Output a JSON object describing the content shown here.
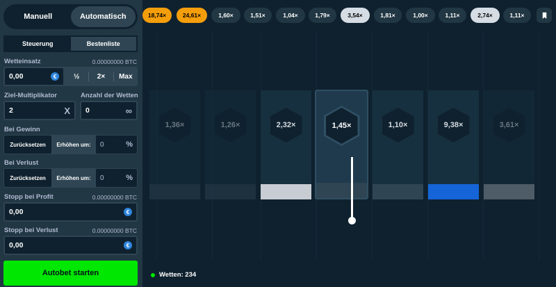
{
  "mode_toggle": {
    "manual": "Manuell",
    "auto": "Automatisch"
  },
  "subtabs": {
    "controls": "Steuerung",
    "leaderboard": "Bestenliste"
  },
  "bet_amount": {
    "label": "Wetteinsatz",
    "btc": "0.00000000 BTC",
    "value": "0,00",
    "currency_icon": "euro-coin-icon",
    "half": "½",
    "double": "2×",
    "max": "Max"
  },
  "target_multiplier": {
    "label": "Ziel-Multiplikator",
    "value": "2",
    "clear_icon": "x-icon"
  },
  "bet_count": {
    "label": "Anzahl der Wetten",
    "value": "0",
    "infinite_icon": "infinity-icon"
  },
  "on_win": {
    "label": "Bei Gewinn",
    "reset": "Zurücksetzen",
    "increase": "Erhöhen um:",
    "value": "0",
    "unit": "%"
  },
  "on_loss": {
    "label": "Bei Verlust",
    "reset": "Zurücksetzen",
    "increase": "Erhöhen um:",
    "value": "0",
    "unit": "%"
  },
  "stop_profit": {
    "label": "Stopp bei Profit",
    "btc": "0.00000000 BTC",
    "value": "0,00"
  },
  "stop_loss": {
    "label": "Stopp bei Verlust",
    "btc": "0.00000000 BTC",
    "value": "0,00"
  },
  "start_button": "Autobet starten",
  "history": [
    "18,74×",
    "24,61×",
    "1,60×",
    "1,51×",
    "1,04×",
    "1,79×",
    "3,54×",
    "1,81×",
    "1,00×",
    "1,11×",
    "2,74×",
    "1,11×"
  ],
  "history_icon": "bookmark-icon",
  "cards": [
    "1,36×",
    "1,26×",
    "2,32×",
    "1,45×",
    "1,10×",
    "9,38×",
    "3,61×"
  ],
  "bets_status": "Wetten: 234",
  "colors": {
    "accent_green": "#00e701",
    "orange": "#f59e0b",
    "blue_bar": "#1565d8",
    "grey_bar": "#c7cdd3"
  }
}
